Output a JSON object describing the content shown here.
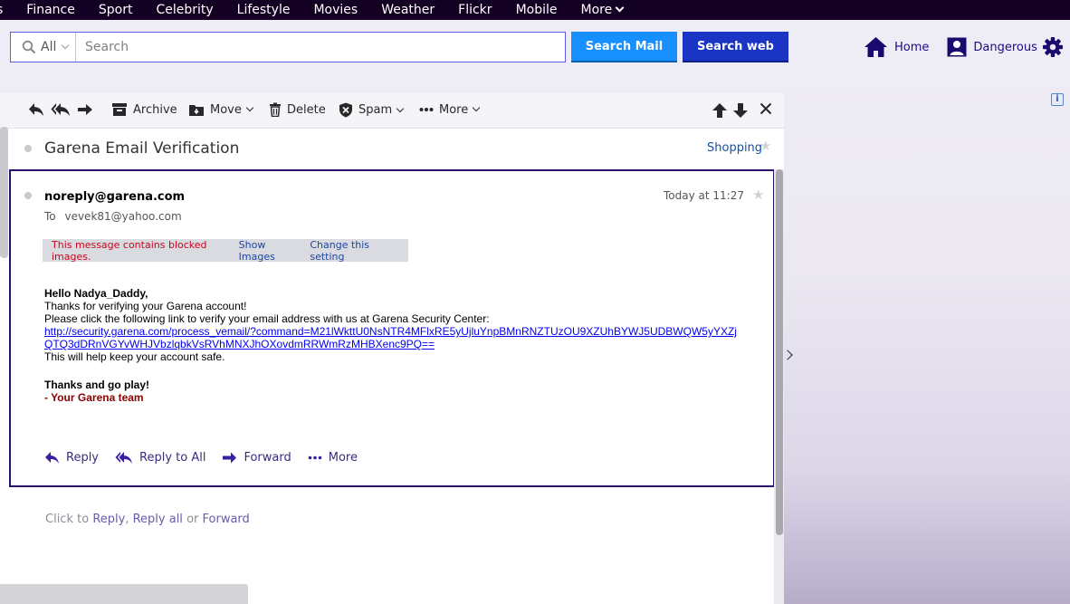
{
  "topnav": {
    "items": [
      "s",
      "Finance",
      "Sport",
      "Celebrity",
      "Lifestyle",
      "Movies",
      "Weather",
      "Flickr",
      "Mobile",
      "More"
    ]
  },
  "search": {
    "scope": "All",
    "placeholder": "Search",
    "search_mail_label": "Search Mail",
    "search_web_label": "Search web"
  },
  "header_links": {
    "home": "Home",
    "user": "Dangerous"
  },
  "toolbar": {
    "archive": "Archive",
    "move": "Move",
    "delete": "Delete",
    "spam": "Spam",
    "more": "More"
  },
  "email": {
    "subject": "Garena Email Verification",
    "folder": "Shopping",
    "sender": "noreply@garena.com",
    "to_label": "To",
    "recipient": "vevek81@yahoo.com",
    "date": "Today at 11:27",
    "blocked_notice": "This message contains blocked images.",
    "show_images": "Show Images",
    "change_setting": "Change this setting",
    "body": {
      "greeting": "Hello Nadya_Daddy,",
      "line1": "Thanks for verifying your Garena account!",
      "line2": "Please click the following link to verify your email address with us at Garena Security Center:",
      "link": "http://security.garena.com/process_vemail/?command=M21lWkttU0NsNTR4MFlxRE5yUjluYnpBMnRNZTUzOU9XZUhBYWJ5UDBWQW5yYXZjQTQ3dDRnVGYvWHJVbzlqbkVsRVhMNXJhOXovdmRRWmRzMHBXenc9PQ==",
      "line3": "This will help keep your account safe.",
      "signoff": "Thanks and go play!",
      "team": "- Your Garena team"
    },
    "actions": {
      "reply": "Reply",
      "reply_all": "Reply to All",
      "forward": "Forward",
      "more": "More"
    },
    "quick_reply": {
      "prefix": "Click to",
      "reply": "Reply",
      "reply_all": "Reply all",
      "or": "or",
      "forward": "Forward"
    }
  },
  "colors": {
    "topnav_bg": "#140022",
    "search_mail_btn": "#188fff",
    "search_web_btn": "#1a35c4",
    "accent_purple": "#2a0f6e",
    "warning_red": "#d0021b"
  }
}
